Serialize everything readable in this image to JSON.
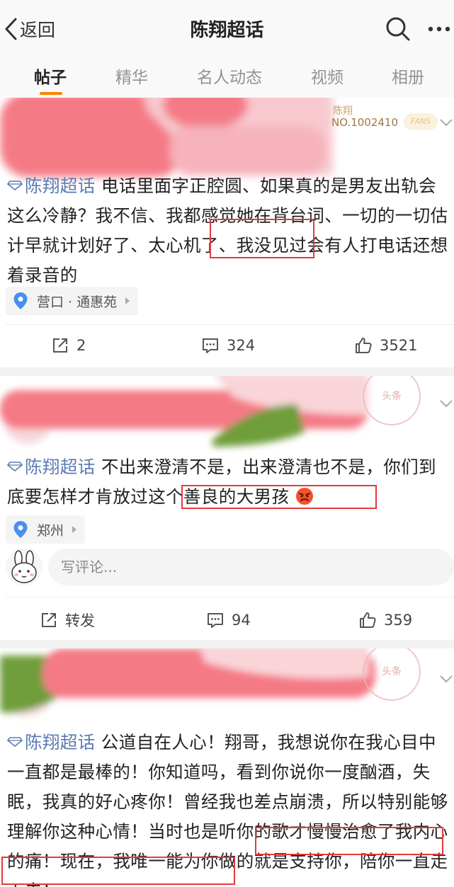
{
  "header": {
    "back_label": "返回",
    "title": "陈翔超话"
  },
  "tabs": [
    {
      "label": "帖子",
      "active": true
    },
    {
      "label": "精华",
      "active": false
    },
    {
      "label": "名人动态",
      "active": false
    },
    {
      "label": "视频",
      "active": false
    },
    {
      "label": "相册",
      "active": false
    }
  ],
  "posts": [
    {
      "fan_badge": {
        "name": "陈翔",
        "number": "NO.1002410",
        "tag": "FANS"
      },
      "topic": "陈翔超话",
      "text": "电话里面字正腔圆、如果真的是男友出轨会这么冷静？我不信、我都感觉她在背台词、一切的一切估计早就计划好了、太心机了、我没见过会有人打电话还想着录音的",
      "highlight": "太心机了、",
      "location": "营口 · 通惠苑",
      "share": "2",
      "comments": "324",
      "likes": "3521"
    },
    {
      "stamp": "头条",
      "topic": "陈翔超话",
      "text": "不出来澄清不是，出来澄清也不是，你们到底要怎样才肯放过这个善良的大男孩",
      "highlight": "这个善良的大男孩",
      "emoji": "angry-face-emoji",
      "location": "郑州",
      "comment_placeholder": "写评论...",
      "share": "转发",
      "comments": "94",
      "likes": "359"
    },
    {
      "stamp": "头条",
      "topic": "陈翔超话",
      "text": "公道自在人心！翔哥，我想说你在我心目中一直都是最棒的！你知道吗，看到你说你一度酗酒，失眠，我真的好心疼你！曾经我也差点崩溃，所以特别能够理解你这种心情！当时也是听你的歌才慢慢治愈了我内心的痛！现在，我唯一能为你做的就是支持你，陪你一直走下去！",
      "highlight": "我唯一能为你做的就是支持你，陪你一直走下去！"
    }
  ],
  "colors": {
    "accent": "#ff8200",
    "topic": "#5b7bb3",
    "highlight_box": "#e53a3a",
    "blur_pink": "#f47a86",
    "blur_green": "#6f9e3a"
  }
}
